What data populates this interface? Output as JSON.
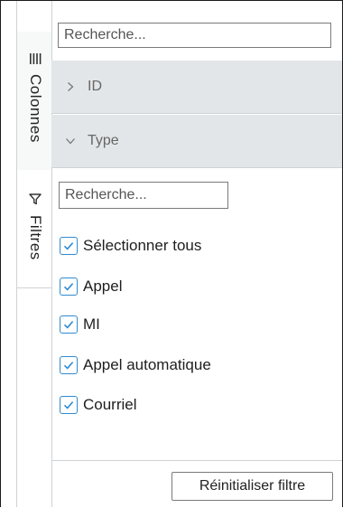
{
  "columns_search": {
    "placeholder": "Recherche..."
  },
  "side_tabs": {
    "columns": "Colonnes",
    "filters": "Filtres"
  },
  "groups": [
    {
      "label": "ID",
      "state": "collapsed"
    },
    {
      "label": "Type",
      "state": "expanded"
    }
  ],
  "filter": {
    "search_placeholder": "Recherche...",
    "options": [
      {
        "label": "Sélectionner tous",
        "checked": true
      },
      {
        "label": "Appel",
        "checked": true
      },
      {
        "label": "MI",
        "checked": true
      },
      {
        "label": "Appel automatique",
        "checked": true
      },
      {
        "label": "Courriel",
        "checked": true
      }
    ],
    "reset_label": "Réinitialiser filtre"
  },
  "colors": {
    "accent": "#2f8bd1",
    "group_bg": "#e3e6e8",
    "border": "#cfd3d6"
  }
}
